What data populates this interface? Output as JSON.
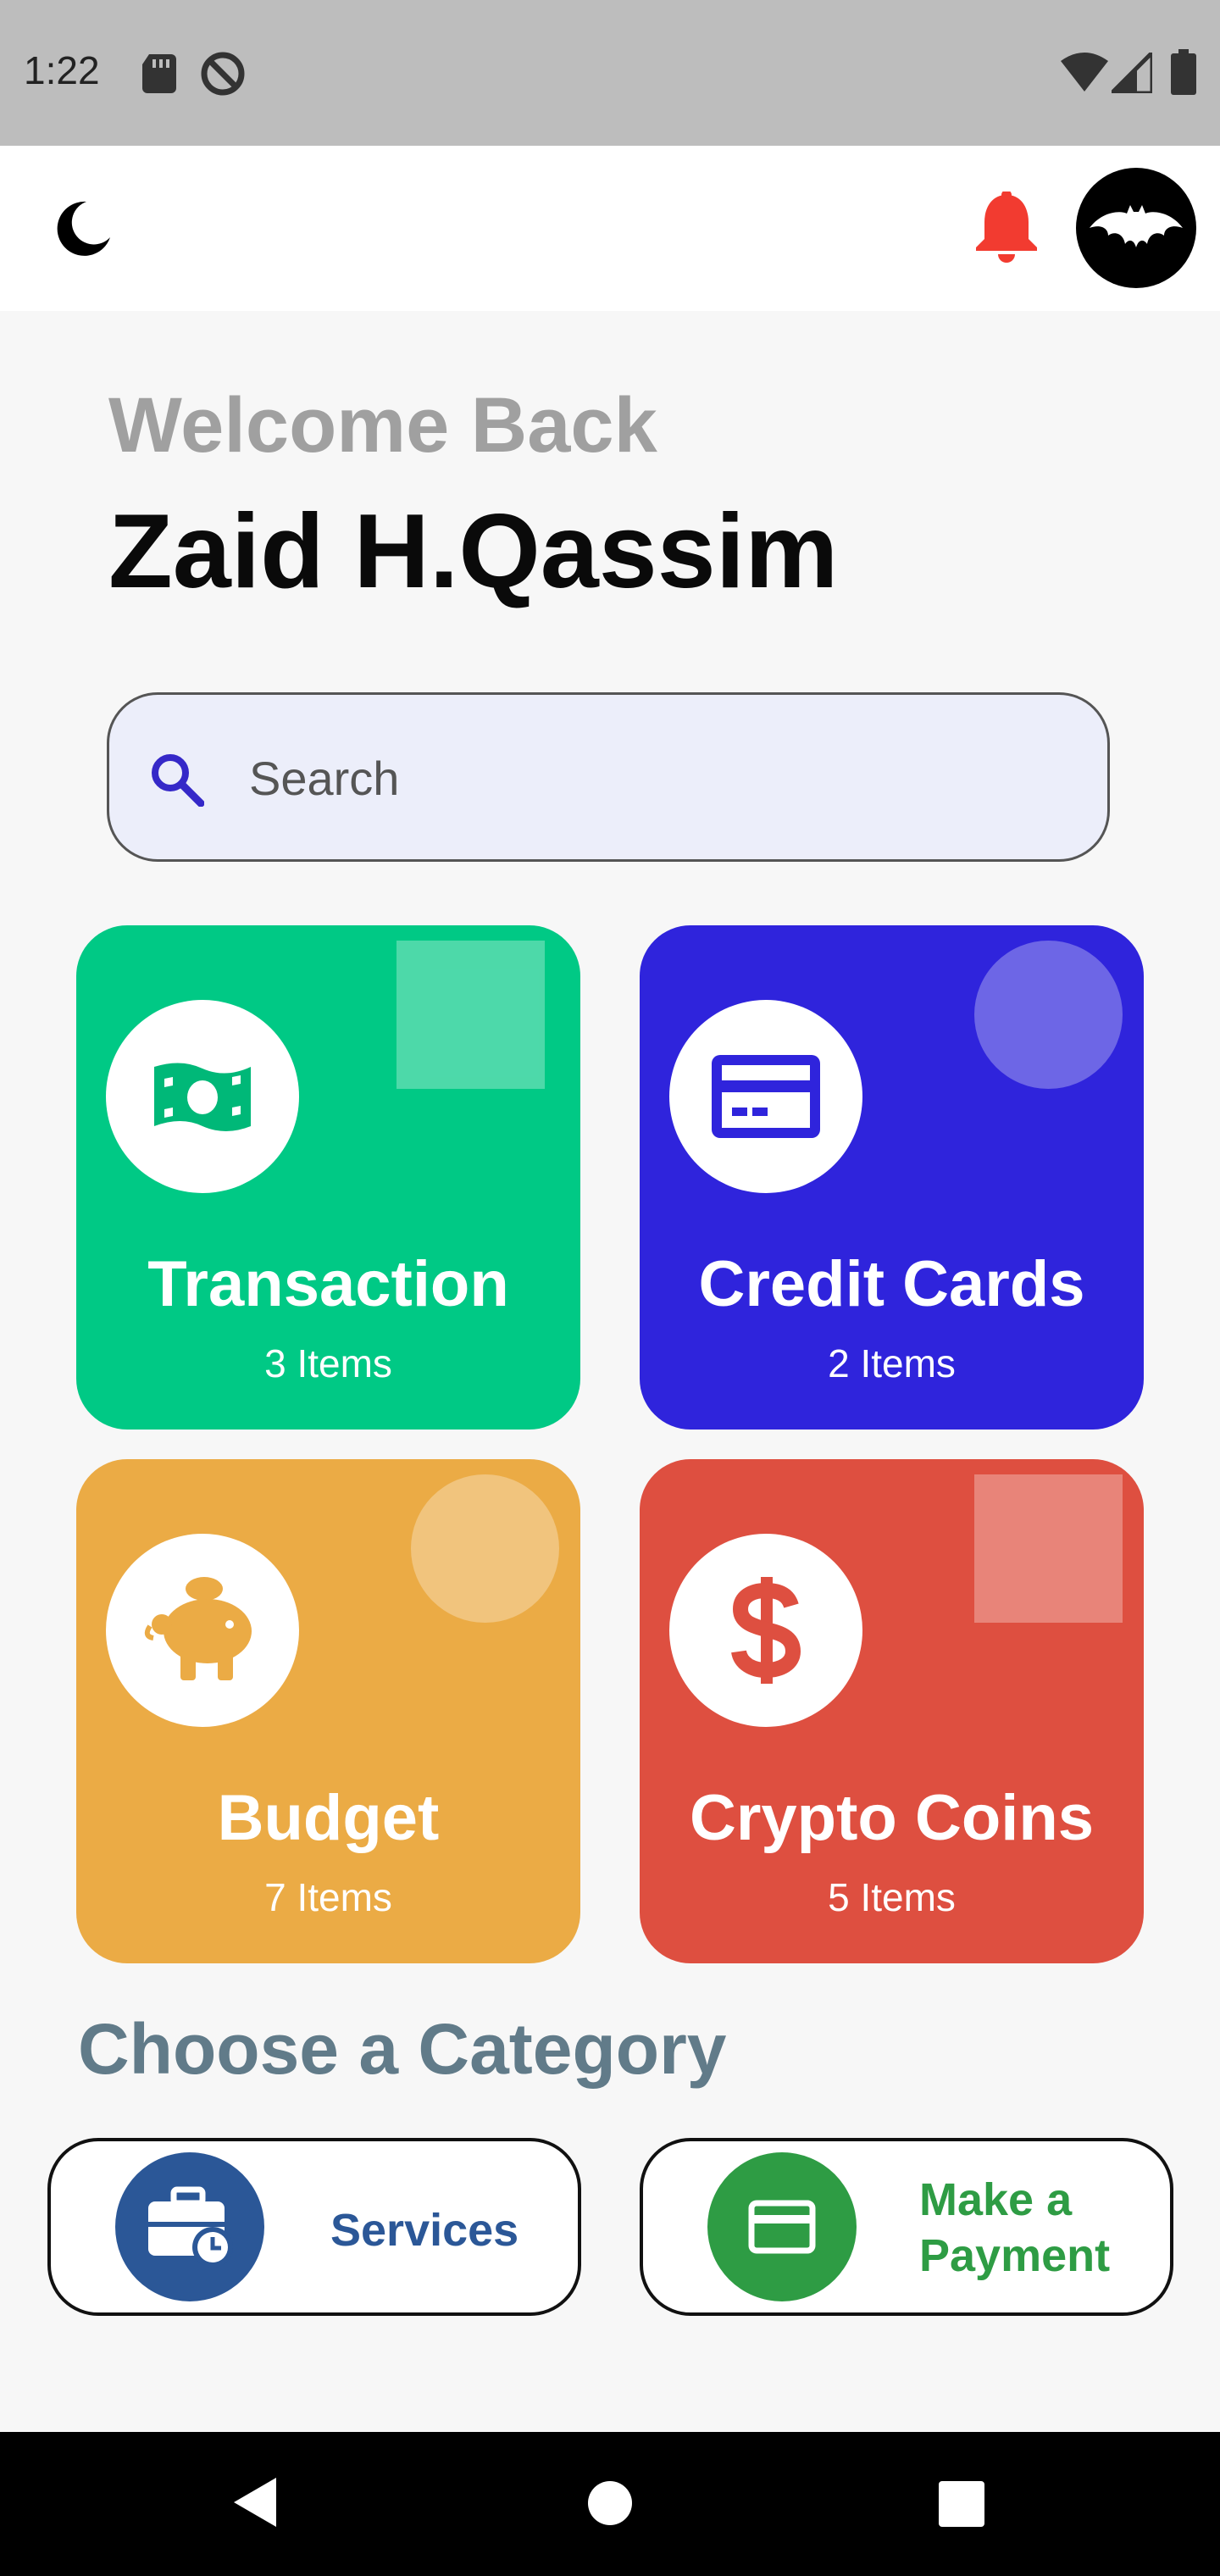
{
  "status_bar": {
    "time": "1:22",
    "left_icons": [
      "sd-card-icon",
      "do-not-disturb-icon"
    ],
    "right_icons": [
      "wifi-icon",
      "signal-icon",
      "battery-icon"
    ]
  },
  "app_bar": {
    "theme_icon": "moon-icon",
    "notification_icon": "bell-icon",
    "avatar_icon": "bat-logo-icon"
  },
  "header": {
    "welcome": "Welcome Back",
    "username": "Zaid H.Qassim"
  },
  "search": {
    "placeholder": "Search",
    "icon": "search-icon"
  },
  "cards": [
    {
      "title": "Transaction",
      "count": "3 Items",
      "color": "#00c985",
      "icon": "money-icon"
    },
    {
      "title": "Credit Cards",
      "count": "2 Items",
      "color": "#2f24dc",
      "icon": "credit-card-icon"
    },
    {
      "title": "Budget",
      "count": "7 Items",
      "color": "#ebab45",
      "icon": "piggy-bank-icon"
    },
    {
      "title": "Crypto Coins",
      "count": "5 Items",
      "color": "#de4f40",
      "icon": "dollar-icon"
    }
  ],
  "category": {
    "title": "Choose a Category",
    "services": {
      "label": "Services",
      "color": "#2b5797",
      "icon": "briefcase-clock-icon"
    },
    "payment": {
      "label_line1": "Make a",
      "label_line2": "Payment",
      "color": "#2e9c44",
      "icon": "payment-card-icon"
    }
  },
  "nav_bar": {
    "back_icon": "back-icon",
    "home_icon": "home-icon",
    "recents_icon": "recents-icon"
  }
}
